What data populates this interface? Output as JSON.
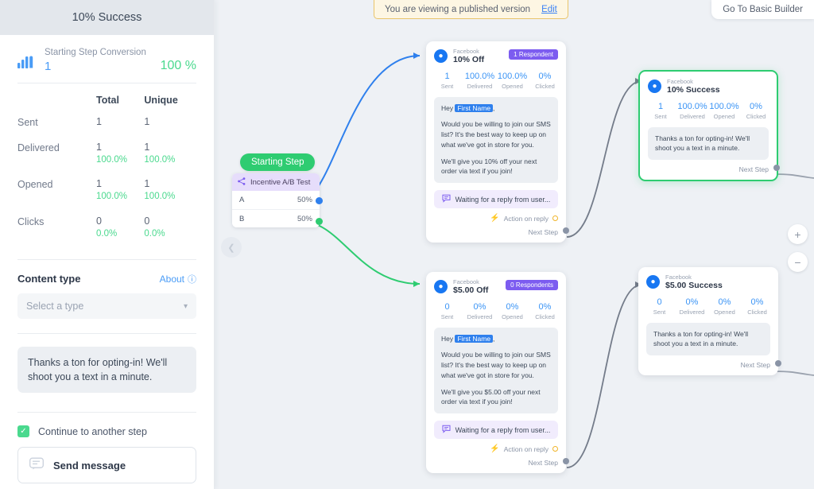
{
  "sidebar": {
    "header_title": "10% Success",
    "conversion": {
      "label": "Starting Step Conversion",
      "count": "1",
      "percent": "100 %",
      "icon": "bar-chart-icon"
    },
    "stats": {
      "col_blank": "",
      "col_total": "Total",
      "col_unique": "Unique",
      "rows": [
        {
          "name": "Sent",
          "total": "1",
          "total_pct": "",
          "unique": "1",
          "unique_pct": ""
        },
        {
          "name": "Delivered",
          "total": "1",
          "total_pct": "100.0%",
          "unique": "1",
          "unique_pct": "100.0%"
        },
        {
          "name": "Opened",
          "total": "1",
          "total_pct": "100.0%",
          "unique": "1",
          "unique_pct": "100.0%"
        },
        {
          "name": "Clicks",
          "total": "0",
          "total_pct": "0.0%",
          "unique": "0",
          "unique_pct": "0.0%"
        }
      ]
    },
    "content_type": {
      "title": "Content type",
      "about": "About",
      "about_icon": "help-circle-icon",
      "select_value": "Select a type",
      "select_placeholder": "Select a type",
      "chevron": "chevron-down-icon"
    },
    "message_text": "Thanks a ton for opting-in! We'll shoot you a text in a minute.",
    "continue": {
      "label": "Continue to another step",
      "checked": true,
      "check_glyph": "✓"
    },
    "send_card": {
      "label": "Send message",
      "icon": "message-lines-icon"
    }
  },
  "canvas": {
    "published_banner": {
      "text": "You are viewing a published version",
      "edit_label": "Edit"
    },
    "basic_builder_label": "Go To Basic Builder",
    "collapse_icon": "chevron-left-icon",
    "zoom_in": "+",
    "zoom_out": "−",
    "start_pill": "Starting Step",
    "ab_node": {
      "icon": "share-split-icon",
      "title": "Incentive A/B Test",
      "rows": [
        {
          "label": "A",
          "percent": "50%",
          "port_color": "#2f80ed"
        },
        {
          "label": "B",
          "percent": "50%",
          "port_color": "#2ecc71"
        }
      ]
    },
    "cards": [
      {
        "channel": "Facebook",
        "title": "10% Off",
        "badge": "1 Respondent",
        "metrics": [
          {
            "value": "1",
            "label": "Sent"
          },
          {
            "value": "100.0%",
            "label": "Delivered"
          },
          {
            "value": "100.0%",
            "label": "Opened"
          },
          {
            "value": "0%",
            "label": "Clicked"
          }
        ],
        "greeting_pre": "Hey ",
        "greeting_tag": "First Name",
        "greeting_post": ",",
        "body1": "Would you be willing to join our SMS list? It's the best way to keep up on what we've got in store for you.",
        "body2": "We'll give you 10% off your next order via text if you join!",
        "wait_text": "Waiting for a reply from user...",
        "wait_icon": "chat-bubble-icon",
        "action_text": "Action on reply",
        "action_icon": "lightning-icon",
        "next_text": "Next Step",
        "selected": false
      },
      {
        "channel": "Facebook",
        "title": "10% Success",
        "badge": "",
        "metrics": [
          {
            "value": "1",
            "label": "Sent"
          },
          {
            "value": "100.0%",
            "label": "Delivered"
          },
          {
            "value": "100.0%",
            "label": "Opened"
          },
          {
            "value": "0%",
            "label": "Clicked"
          }
        ],
        "body1": "Thanks a ton for opting-in! We'll shoot you a text in a minute.",
        "next_text": "Next Step",
        "selected": true
      },
      {
        "channel": "Facebook",
        "title": "$5.00 Off",
        "badge": "0 Respondents",
        "metrics": [
          {
            "value": "0",
            "label": "Sent"
          },
          {
            "value": "0%",
            "label": "Delivered"
          },
          {
            "value": "0%",
            "label": "Opened"
          },
          {
            "value": "0%",
            "label": "Clicked"
          }
        ],
        "greeting_pre": "Hey ",
        "greeting_tag": "First Name",
        "greeting_post": ",",
        "body1": "Would you be willing to join our SMS list? It's the best way to keep up on what we've got in store for you.",
        "body2": "We'll give you $5.00 off your next order via text if you join!",
        "wait_text": "Waiting for a reply from user...",
        "wait_icon": "chat-bubble-icon",
        "action_text": "Action on reply",
        "action_icon": "lightning-icon",
        "next_text": "Next Step",
        "selected": false
      },
      {
        "channel": "Facebook",
        "title": "$5.00 Success",
        "badge": "",
        "metrics": [
          {
            "value": "0",
            "label": "Sent"
          },
          {
            "value": "0%",
            "label": "Delivered"
          },
          {
            "value": "0%",
            "label": "Opened"
          },
          {
            "value": "0%",
            "label": "Clicked"
          }
        ],
        "body1": "Thanks a ton for opting-in! We'll shoot you a text in a minute.",
        "next_text": "Next Step",
        "selected": false
      }
    ]
  },
  "colors": {
    "accent_blue": "#3b94f5",
    "green": "#2ecc71",
    "purple": "#7c5cf0",
    "amber": "#f0b429",
    "canvas_bg": "#eef1f5"
  }
}
